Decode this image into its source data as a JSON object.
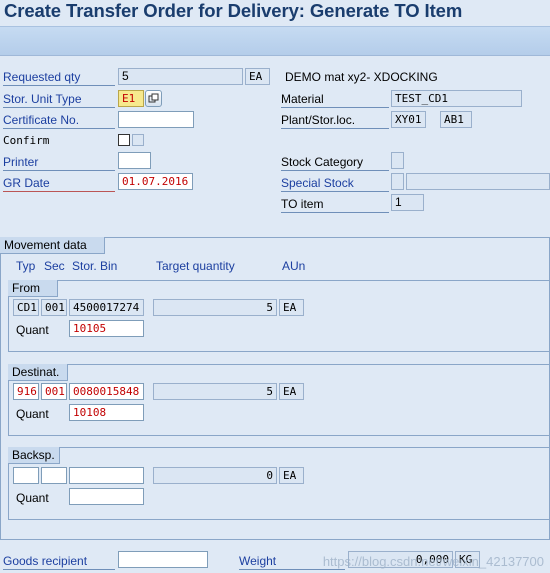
{
  "title": "Create Transfer Order for Delivery: Generate TO Item",
  "header": {
    "requested_qty_label": "Requested qty",
    "requested_qty_value": "5",
    "requested_qty_unit": "EA",
    "material_text": "DEMO mat xy2- XDOCKING",
    "stor_unit_type_label": "Stor. Unit Type",
    "stor_unit_type_value": "E1",
    "material_label": "Material",
    "material_value": "TEST_CD1",
    "certificate_label": "Certificate No.",
    "certificate_value": "",
    "plant_label": "Plant/Stor.loc.",
    "plant_value": "XY01",
    "storloc_value": "AB1",
    "confirm_label": "Confirm",
    "printer_label": "Printer",
    "printer_value": "",
    "stock_category_label": "Stock Category",
    "stock_category_value": "",
    "gr_date_label": "GR Date",
    "gr_date_value": "01.07.2016",
    "special_stock_label": "Special Stock",
    "special_stock_value": "",
    "special_stock_desc": "",
    "to_item_label": "TO item",
    "to_item_value": "1"
  },
  "movement": {
    "group_title": "Movement data",
    "col_typ": "Typ",
    "col_sec": "Sec",
    "col_bin": "Stor. Bin",
    "col_target": "Target quantity",
    "col_aun": "AUn",
    "from": {
      "title": "From",
      "typ": "CD1",
      "sec": "001",
      "bin": "4500017274",
      "qty": "5",
      "unit": "EA",
      "quant_label": "Quant",
      "quant": "10105"
    },
    "dest": {
      "title": "Destinat.",
      "typ": "916",
      "sec": "001",
      "bin": "0080015848",
      "qty": "5",
      "unit": "EA",
      "quant_label": "Quant",
      "quant": "10108"
    },
    "backsp": {
      "title": "Backsp.",
      "typ": "",
      "sec": "",
      "bin": "",
      "qty": "0",
      "unit": "EA",
      "quant_label": "Quant",
      "quant": ""
    }
  },
  "footer": {
    "goods_recipient_label": "Goods recipient",
    "goods_recipient_value": "",
    "weight_label": "Weight",
    "weight_value": "0,000",
    "weight_unit": "KG"
  },
  "watermark": "https://blog.csdn.net/weixin_42137700"
}
